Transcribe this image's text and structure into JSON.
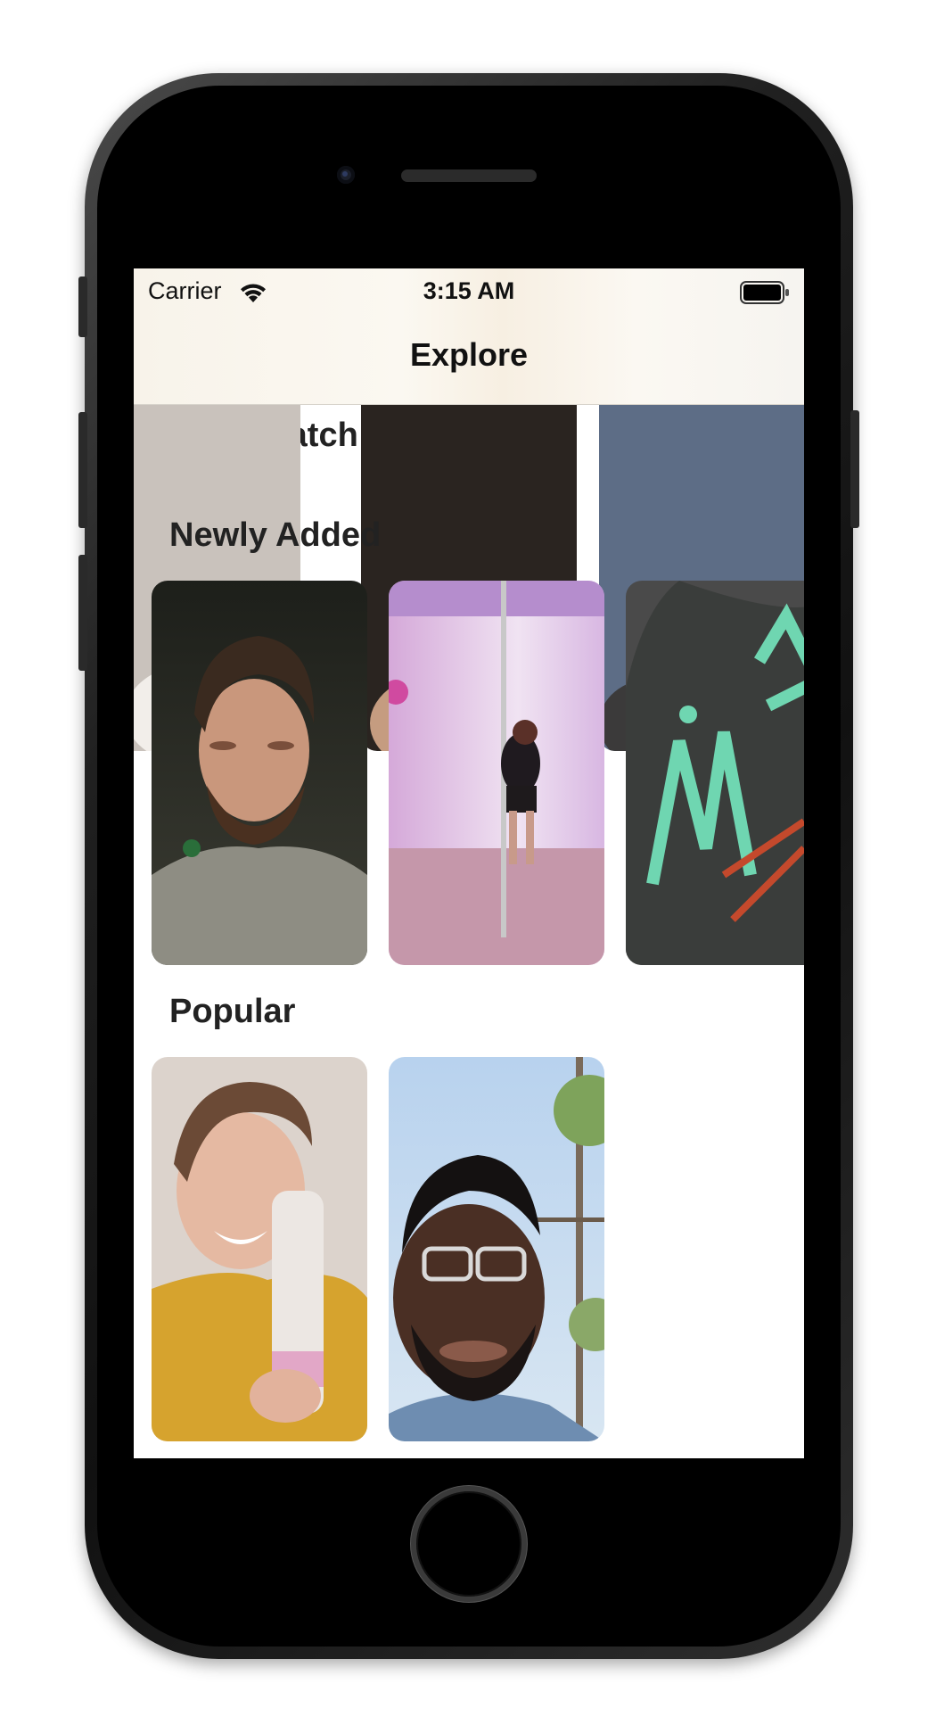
{
  "status_bar": {
    "carrier": "Carrier",
    "time": "3:15 AM"
  },
  "nav": {
    "title": "Explore"
  },
  "sections": [
    {
      "heading": "Must Watch",
      "thumbnails": [
        "must-watch-1",
        "must-watch-2",
        "must-watch-3"
      ]
    },
    {
      "heading": "Newly Added",
      "thumbnails": [
        "newly-added-1",
        "newly-added-2",
        "newly-added-3"
      ]
    },
    {
      "heading": "Popular",
      "thumbnails": [
        "popular-1",
        "popular-2"
      ]
    }
  ],
  "icons": [
    "wifi-icon",
    "battery-icon",
    "home-button"
  ],
  "colors": {
    "nav_background": "#f8f3ea",
    "screen_background": "#ffffff",
    "device_bezel": "#000000"
  }
}
